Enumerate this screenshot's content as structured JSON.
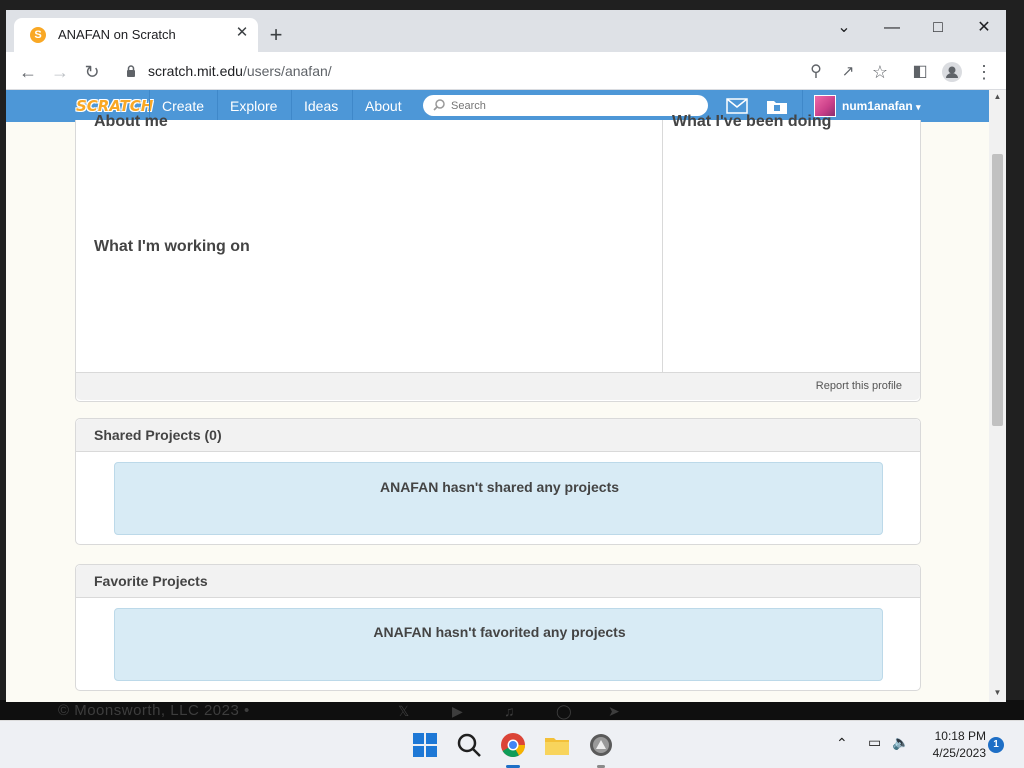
{
  "browser": {
    "tab_title": "ANAFAN on Scratch",
    "url_host": "scratch.mit.edu",
    "url_path": "/users/anafan/"
  },
  "scratch_nav": {
    "logo": "SCRATCH",
    "links": [
      "Create",
      "Explore",
      "Ideas",
      "About"
    ],
    "search_placeholder": "Search",
    "username": "num1anafan"
  },
  "profile": {
    "about_me_heading": "About me",
    "working_on_heading": "What I'm working on",
    "been_doing_heading": "What I've been doing",
    "report_link": "Report this profile"
  },
  "shared_projects": {
    "heading": "Shared Projects (0)",
    "empty_message": "ANAFAN hasn't shared any projects"
  },
  "favorite_projects": {
    "heading": "Favorite Projects",
    "empty_message": "ANAFAN hasn't favorited any projects"
  },
  "background": {
    "footer_text": "© Moonsworth, LLC 2023 •"
  },
  "taskbar": {
    "time": "10:18 PM",
    "date": "4/25/2023",
    "notification_count": "1"
  },
  "colors": {
    "scratch_blue": "#4d97d7",
    "empty_box": "#d8ebf5",
    "page_bg": "#fcfbf4"
  }
}
